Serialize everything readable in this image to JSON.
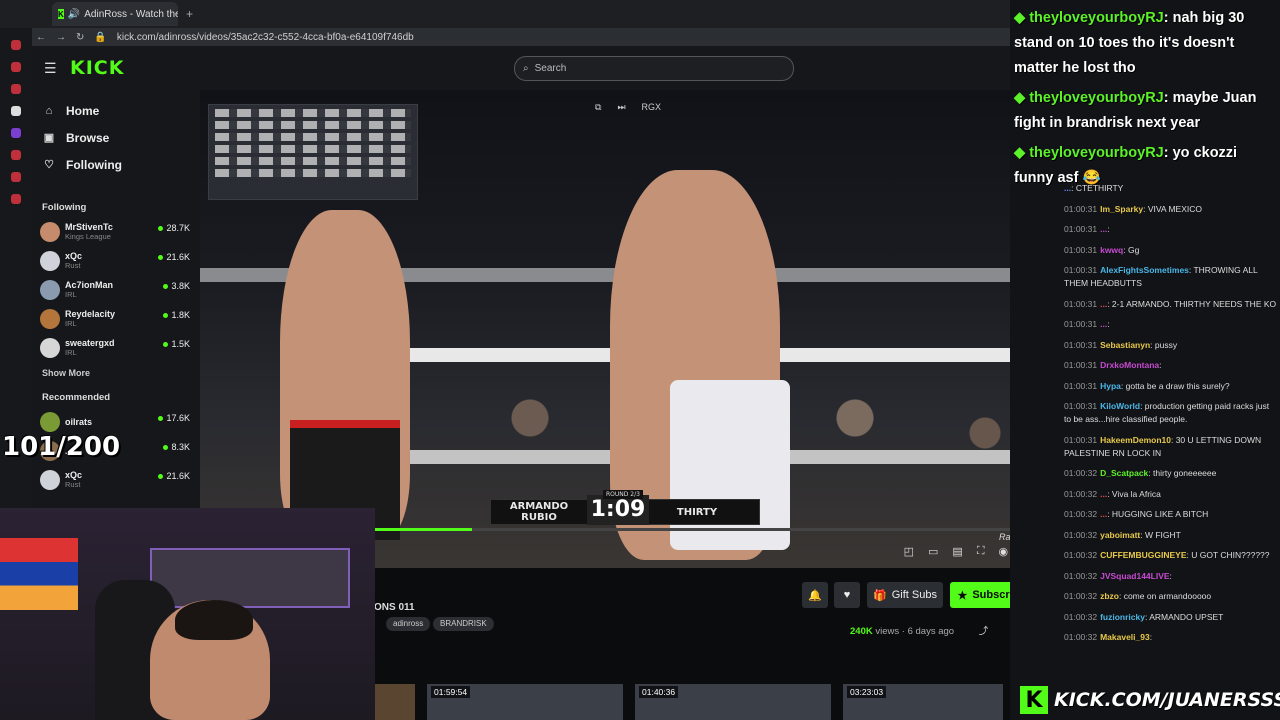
{
  "browser": {
    "tab_title": "AdinRoss - Watch the",
    "url": "kick.com/adinross/videos/35ac2c32-c552-4cca-bf0a-e64109f746db"
  },
  "header": {
    "logo": "KICK",
    "search_placeholder": "Search"
  },
  "sidebar": {
    "nav": [
      {
        "label": "Home",
        "icon": "home-icon"
      },
      {
        "label": "Browse",
        "icon": "browse-icon"
      },
      {
        "label": "Following",
        "icon": "heart-icon"
      }
    ],
    "following_title": "Following",
    "following": [
      {
        "name": "MrStivenTc",
        "category": "Kings League",
        "viewers": "28.7K",
        "color": "#c58b6c"
      },
      {
        "name": "xQc",
        "category": "Rust",
        "viewers": "21.6K",
        "color": "#cfd2d8"
      },
      {
        "name": "Ac7ionMan",
        "category": "IRL",
        "viewers": "3.8K",
        "color": "#8a9bb0"
      },
      {
        "name": "Reydelacity",
        "category": "IRL",
        "viewers": "1.8K",
        "color": "#b3753b"
      },
      {
        "name": "sweatergxd",
        "category": "IRL",
        "viewers": "1.5K",
        "color": "#d6d6d6"
      }
    ],
    "show_more": "Show More",
    "recommended_title": "Recommended",
    "recommended": [
      {
        "name": "oilrats",
        "category": "",
        "viewers": "17.6K",
        "color": "#7a9a35"
      },
      {
        "name": "...d",
        "category": "",
        "viewers": "8.3K",
        "color": "#8b6d4e"
      },
      {
        "name": "xQc",
        "category": "Rust",
        "viewers": "21.6K",
        "color": "#cfd2d8"
      }
    ]
  },
  "video": {
    "top_controls": [
      "pip-icon",
      "skip-icon",
      "RGX"
    ],
    "score_left": "ARMANDO RUBIO",
    "score_round": "ROUND 2/3",
    "score_clock": "1:09",
    "score_right": "THIRTY",
    "progress": 0.32,
    "watermark": "Rainbet",
    "controls": [
      "clip-icon",
      "theater-icon",
      "captions-icon",
      "fullscreen-icon",
      "speed-icon",
      "settings-icon"
    ]
  },
  "below": {
    "title_fragment": "ONS 011",
    "tags": [
      "adinross",
      "BRANDRISK"
    ],
    "gift_subs": "Gift Subs",
    "subscribe": "Subscribe",
    "views_count": "240K",
    "views_suffix": "views",
    "age": "6 days ago",
    "thumbs": [
      "01:59:54",
      "01:40:36",
      "03:23:03"
    ]
  },
  "overlay": {
    "counter": "101/200",
    "kick_url": "KICK.COM/JUANERSSS"
  },
  "chat": {
    "highlights": [
      {
        "user": "theyloveyourboyRJ",
        "text": ": nah big 30 stand on 10 toes tho it's doesn't matter he lost tho"
      },
      {
        "user": "theyloveyourboyRJ",
        "text": ": maybe Juan fight in brandrisk next year"
      },
      {
        "user": "theyloveyourboyRJ",
        "text": ": yo ckozzi funny asf 😂"
      }
    ],
    "messages": [
      {
        "time": "",
        "user": "...",
        "text": ": CTETHIRTY",
        "color": "#6b8cff"
      },
      {
        "time": "01:00:31",
        "user": "Im_Sparky",
        "text": ": VIVA MEXICO",
        "color": "#e8c94a"
      },
      {
        "time": "01:00:31",
        "user": "...",
        "text": ":",
        "color": "#c54ad1"
      },
      {
        "time": "01:00:31",
        "user": "kwwq",
        "text": ": Gg",
        "color": "#c54ad1"
      },
      {
        "time": "01:00:31",
        "user": "AlexFightsSometimes",
        "text": ": THROWING ALL THEM HEADBUTTS",
        "color": "#4ab7e8"
      },
      {
        "time": "01:00:31",
        "user": "...",
        "text": ": 2-1 ARMANDO. THIRTHY NEEDS THE KO",
        "color": "#e84a4a"
      },
      {
        "time": "01:00:31",
        "user": "...",
        "text": ":",
        "color": "#c54ad1"
      },
      {
        "time": "01:00:31",
        "user": "Sebastianyn",
        "text": ": pussy",
        "color": "#e8c94a"
      },
      {
        "time": "01:00:31",
        "user": "DrxkoMontana",
        "text": ":",
        "color": "#c54ad1"
      },
      {
        "time": "01:00:31",
        "user": "Hypa",
        "text": ": gotta be a draw this surely?",
        "color": "#4ab7e8"
      },
      {
        "time": "01:00:31",
        "user": "KiloWorld",
        "text": ": production getting paid racks just to be ass...hire classified people.",
        "color": "#4ab7e8"
      },
      {
        "time": "01:00:31",
        "user": "HakeemDemon10",
        "text": ": 30 U LETTING DOWN PALESTINE RN LOCK IN",
        "color": "#e8c94a"
      },
      {
        "time": "01:00:32",
        "user": "D_Scatpack",
        "text": ": thirty goneeeeee",
        "color": "#5cf22a"
      },
      {
        "time": "01:00:32",
        "user": "...",
        "text": ": Viva la Africa",
        "color": "#e84a4a"
      },
      {
        "time": "01:00:32",
        "user": "...",
        "text": ": HUGGING LIKE A BITCH",
        "color": "#e84a4a"
      },
      {
        "time": "01:00:32",
        "user": "yaboimatt",
        "text": ": W FIGHT",
        "color": "#e8c94a"
      },
      {
        "time": "01:00:32",
        "user": "CUFFEMBUGGINEYE",
        "text": ": U GOT CHIN??????",
        "color": "#e8c94a"
      },
      {
        "time": "01:00:32",
        "user": "JVSquad144LIVE",
        "text": ":",
        "color": "#c54ad1"
      },
      {
        "time": "01:00:32",
        "user": "zbzo",
        "text": ": come on armandooooo",
        "color": "#e8c94a"
      },
      {
        "time": "01:00:32",
        "user": "fuzionricky",
        "text": ": ARMANDO UPSET",
        "color": "#4ab7e8"
      },
      {
        "time": "01:00:32",
        "user": "Makaveli_93",
        "text": ":",
        "color": "#e8c94a"
      }
    ]
  }
}
